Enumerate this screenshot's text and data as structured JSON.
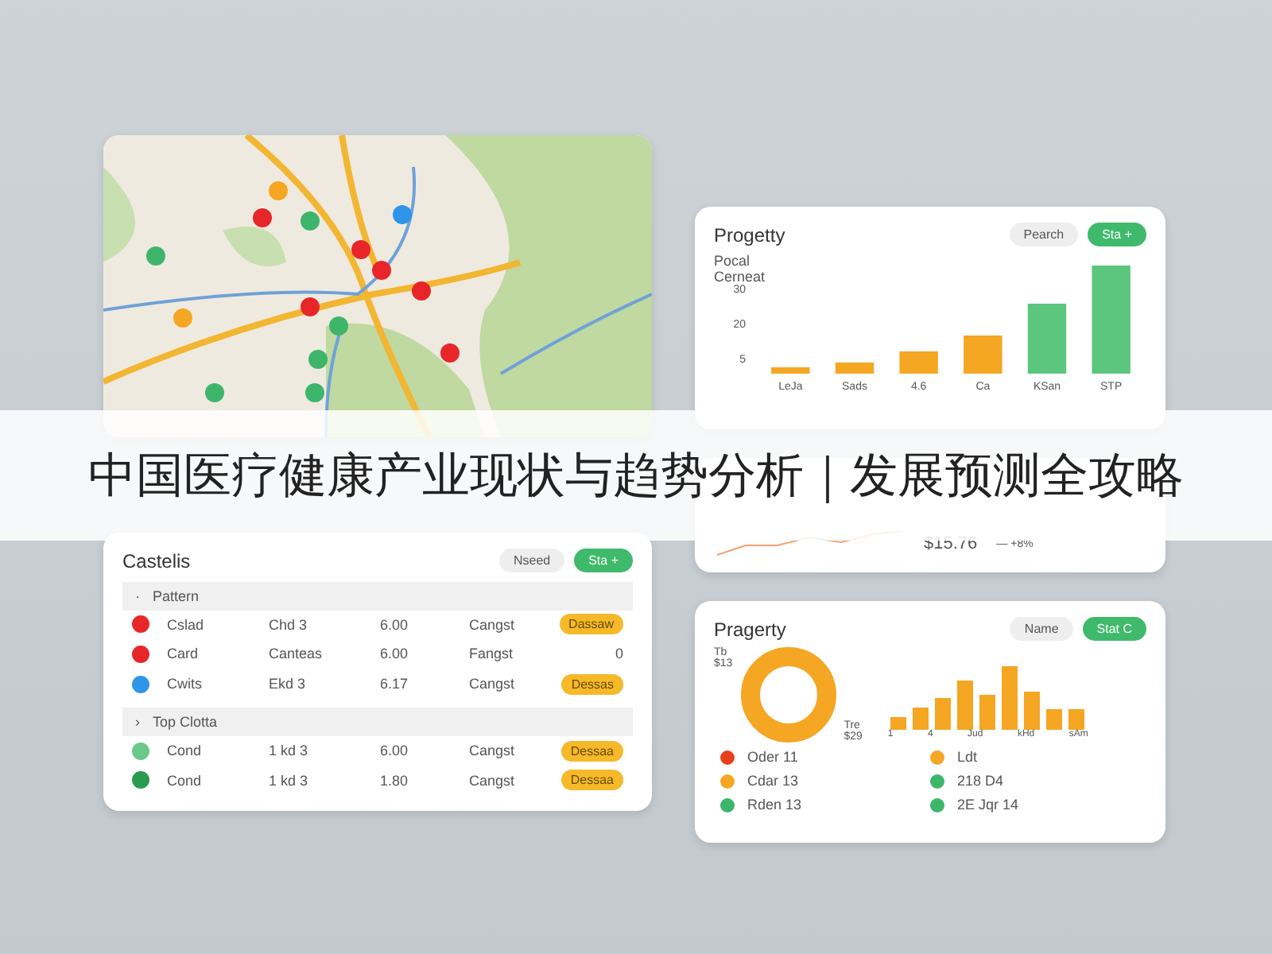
{
  "banner": {
    "title": "中国医疗健康产业现状与趋势分析｜发展预测全攻略"
  },
  "bar_card": {
    "title": "Progetty",
    "buttons": [
      {
        "label": "Pearch",
        "kind": "plain"
      },
      {
        "label": "Sta +",
        "kind": "primary"
      }
    ],
    "caption": [
      "Pocal",
      "Cerneat"
    ],
    "y_ticks": [
      "30",
      "20",
      "5"
    ],
    "x_labels": [
      "LeJa",
      "Sads",
      "4.6",
      "Ca",
      "KSan",
      "STP"
    ]
  },
  "mini_card": {
    "value": "$15.76",
    "delta": "— +8%"
  },
  "table_card": {
    "title": "Castelis",
    "buttons": [
      {
        "label": "Nseed",
        "kind": "plain"
      },
      {
        "label": "Sta +",
        "kind": "primary"
      }
    ],
    "groups": [
      {
        "label": "Pattern",
        "marker": "·",
        "rows": [
          {
            "color": "#e8262a",
            "name": "Cslad",
            "col_2": "Chd 3",
            "col_3": "6.00",
            "col_4": "Cangst",
            "status": "Dassaw",
            "kind": "badge"
          },
          {
            "color": "#e8262a",
            "name": "Card",
            "col_2": "Canteas",
            "col_3": "6.00",
            "col_4": "Fangst",
            "status": "0",
            "kind": "text"
          },
          {
            "color": "#2f95e8",
            "name": "Cwits",
            "col_2": "Ekd 3",
            "col_3": "6.17",
            "col_4": "Cangst",
            "status": "Dessas",
            "kind": "badge"
          }
        ]
      },
      {
        "label": "Top Clotta",
        "marker": "›",
        "rows": [
          {
            "color": "#6cc88a",
            "name": "Cond",
            "col_2": "1 kd 3",
            "col_3": "6.00",
            "col_4": "Cangst",
            "status": "Dessaa",
            "kind": "badge"
          },
          {
            "color": "#2a9a4e",
            "name": "Cond",
            "col_2": "1 kd 3",
            "col_3": "1.80",
            "col_4": "Cangst",
            "status": "Dessaa",
            "kind": "badge"
          }
        ]
      }
    ]
  },
  "donut_card": {
    "title": "Pragerty",
    "buttons": [
      {
        "label": "Name",
        "kind": "plain"
      },
      {
        "label": "Stat C",
        "kind": "primary"
      }
    ],
    "left_label": [
      "Tb",
      "$13"
    ],
    "right_label": [
      "Tre",
      "$29"
    ],
    "x_labels": [
      "1",
      "4",
      "Jud",
      "kHd",
      "sAm"
    ],
    "legend": [
      {
        "color": "#e8401c",
        "label": "Oder 11"
      },
      {
        "color": "#f5a623",
        "label": "Ldt"
      },
      {
        "color": "#f5a623",
        "label": "Cdar 13"
      },
      {
        "color": "#3db56a",
        "label": "218 D4"
      },
      {
        "color": "#3db56a",
        "label": "Rden 13"
      },
      {
        "color": "#3db56a",
        "label": "2E Jqr 14"
      }
    ]
  }
}
